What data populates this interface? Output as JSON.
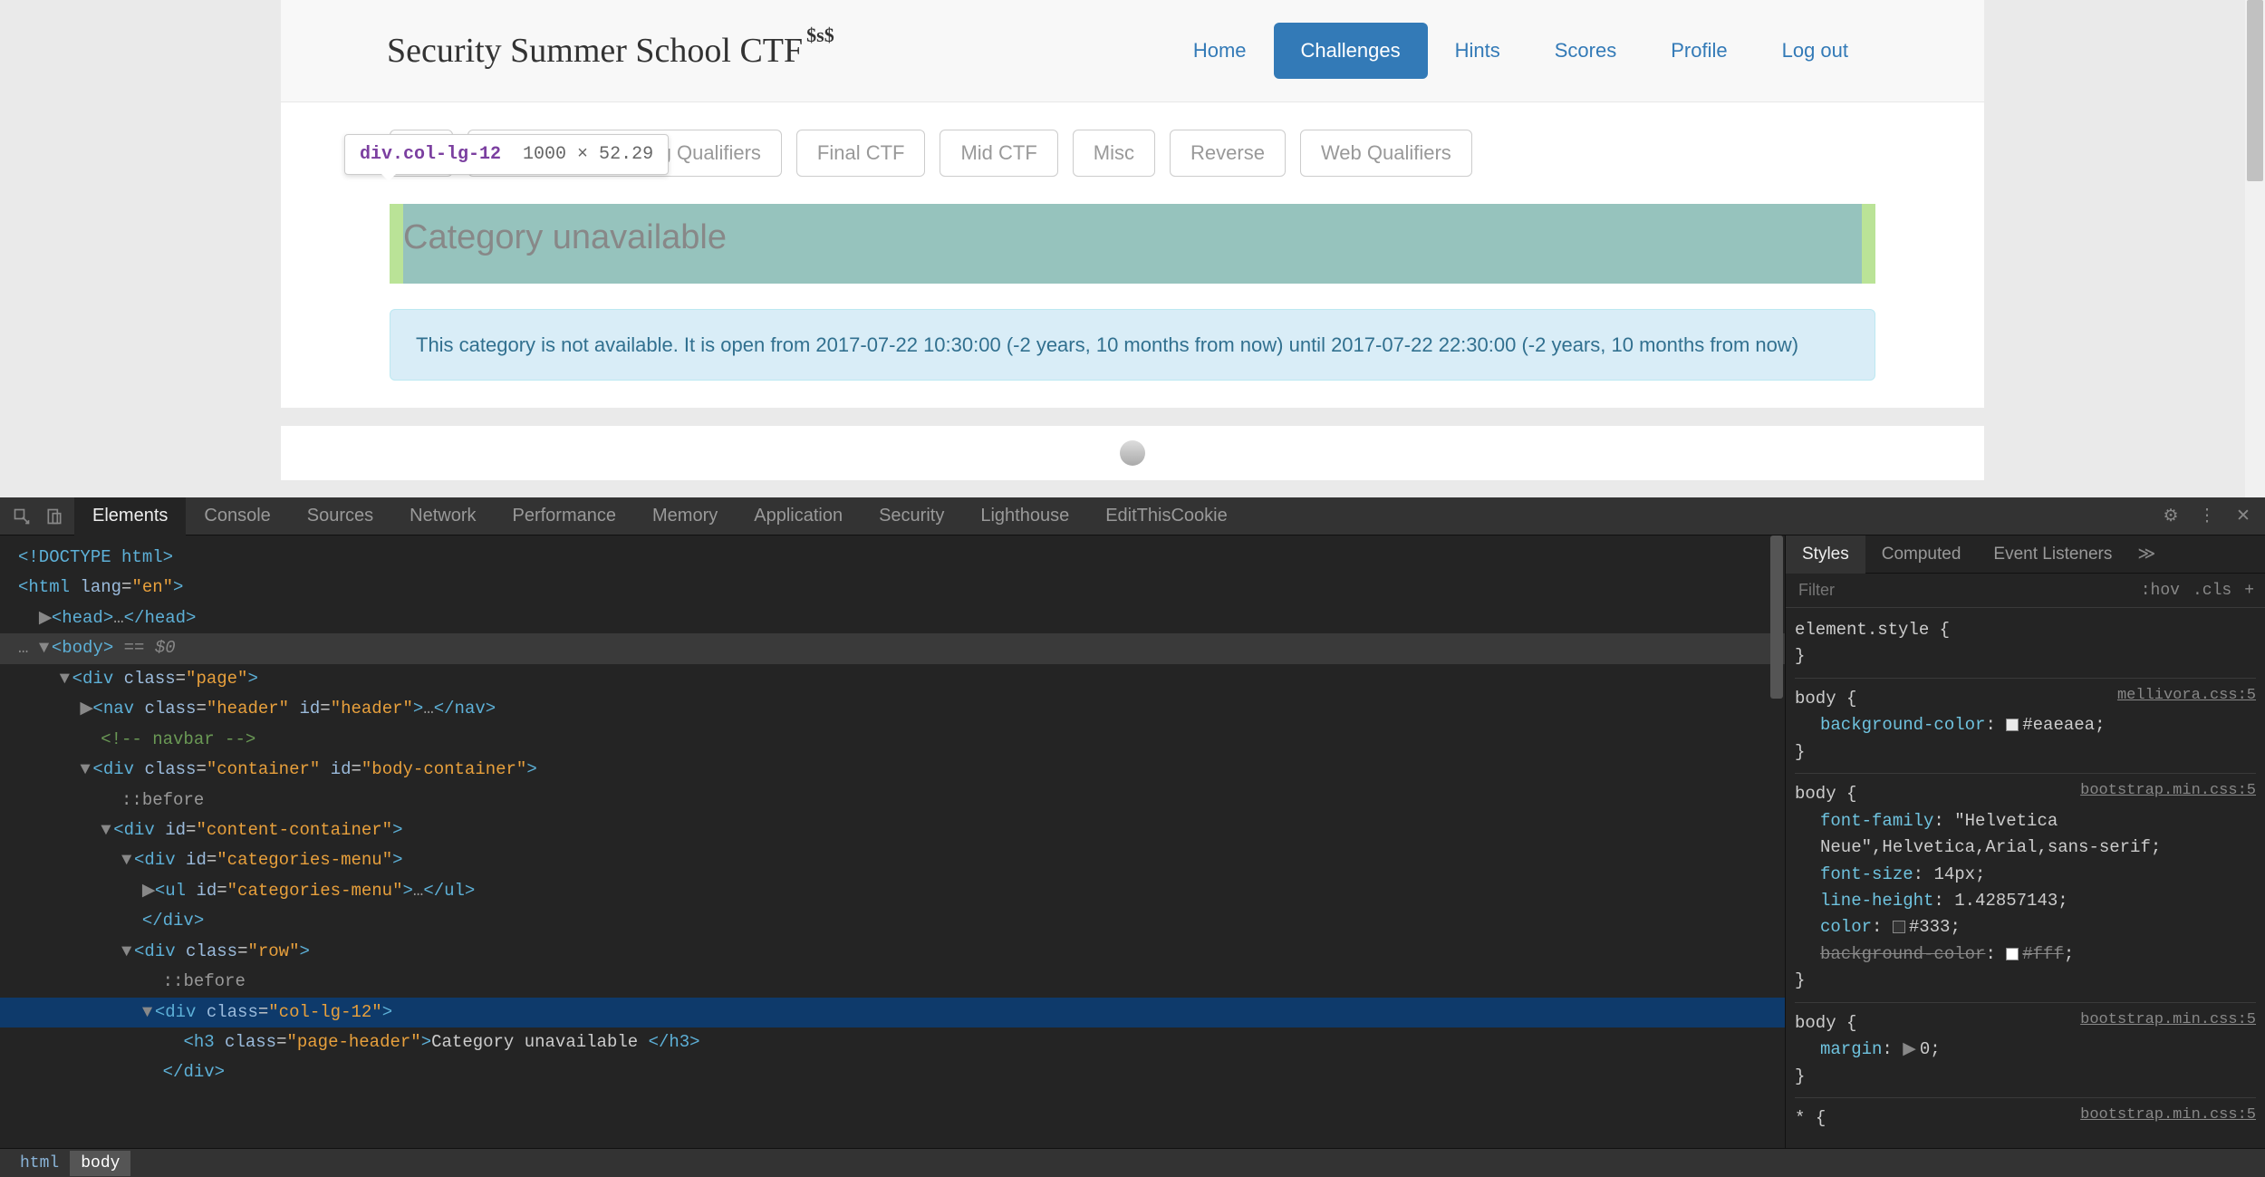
{
  "brand": {
    "title": "Security Summer School CTF",
    "suffix": "$s$"
  },
  "nav": {
    "items": [
      {
        "label": "Home",
        "active": false
      },
      {
        "label": "Challenges",
        "active": true
      },
      {
        "label": "Hints",
        "active": false
      },
      {
        "label": "Scores",
        "active": false
      },
      {
        "label": "Profile",
        "active": false
      },
      {
        "label": "Log out",
        "active": false
      }
    ]
  },
  "categories": [
    "Binary Exploiting Qualifiers",
    "Final CTF",
    "Mid CTF",
    "Misc",
    "Reverse",
    "Web Qualifiers"
  ],
  "inspect_tooltip": {
    "selector": "div.col-lg-12",
    "dimensions": "1000 × 52.29"
  },
  "page_header": "Category unavailable",
  "alert_text": "This category is not available. It is open from 2017-07-22 10:30:00 (-2 years, 10 months from now) until 2017-07-22 22:30:00 (-2 years, 10 months from now)",
  "devtools": {
    "tabs": [
      "Elements",
      "Console",
      "Sources",
      "Network",
      "Performance",
      "Memory",
      "Application",
      "Security",
      "Lighthouse",
      "EditThisCookie"
    ],
    "active_tab": "Elements",
    "breadcrumbs": [
      "html",
      "body"
    ],
    "styles_tabs": [
      "Styles",
      "Computed",
      "Event Listeners"
    ],
    "active_styles_tab": "Styles",
    "filter_placeholder": "Filter",
    "filter_buttons": [
      ":hov",
      ".cls",
      "+"
    ],
    "dom_lines": {
      "doctype": "<!DOCTYPE html>",
      "html_open": "<html lang=\"en\">",
      "head": "<head>…</head>",
      "body_open": "<body>",
      "body_eq": " == $0",
      "page_div": "<div class=\"page\">",
      "nav": "<nav class=\"header\" id=\"header\">…</nav>",
      "comment": "<!-- navbar -->",
      "container": "<div class=\"container\" id=\"body-container\">",
      "before1": "::before",
      "content": "<div id=\"content-container\">",
      "catmenu_div": "<div id=\"categories-menu\">",
      "catmenu_ul": "<ul id=\"categories-menu\">…</ul>",
      "div_close1": "</div>",
      "row": "<div class=\"row\">",
      "before2": "::before",
      "col": "<div class=\"col-lg-12\">",
      "h3": "<h3 class=\"page-header\">Category unavailable </h3>",
      "div_close2": "</div>"
    },
    "rules": [
      {
        "selector": "element.style",
        "src": "",
        "props": []
      },
      {
        "selector": "body",
        "src": "mellivora.css:5",
        "props": [
          {
            "name": "background-color",
            "value": "#eaeaea",
            "swatch": "e"
          }
        ]
      },
      {
        "selector": "body",
        "src": "bootstrap.min.css:5",
        "props": [
          {
            "name": "font-family",
            "value": "\"Helvetica Neue\",Helvetica,Arial,sans-serif"
          },
          {
            "name": "font-size",
            "value": "14px"
          },
          {
            "name": "line-height",
            "value": "1.42857143"
          },
          {
            "name": "color",
            "value": "#333",
            "swatch": "d"
          },
          {
            "name": "background-color",
            "value": "#fff",
            "swatch": "w",
            "struck": true
          }
        ]
      },
      {
        "selector": "body",
        "src": "bootstrap.min.css:5",
        "props": [
          {
            "name": "margin",
            "value": "0",
            "expand": true
          }
        ]
      },
      {
        "selector": "*",
        "src": "bootstrap.min.css:5",
        "props": []
      }
    ]
  }
}
